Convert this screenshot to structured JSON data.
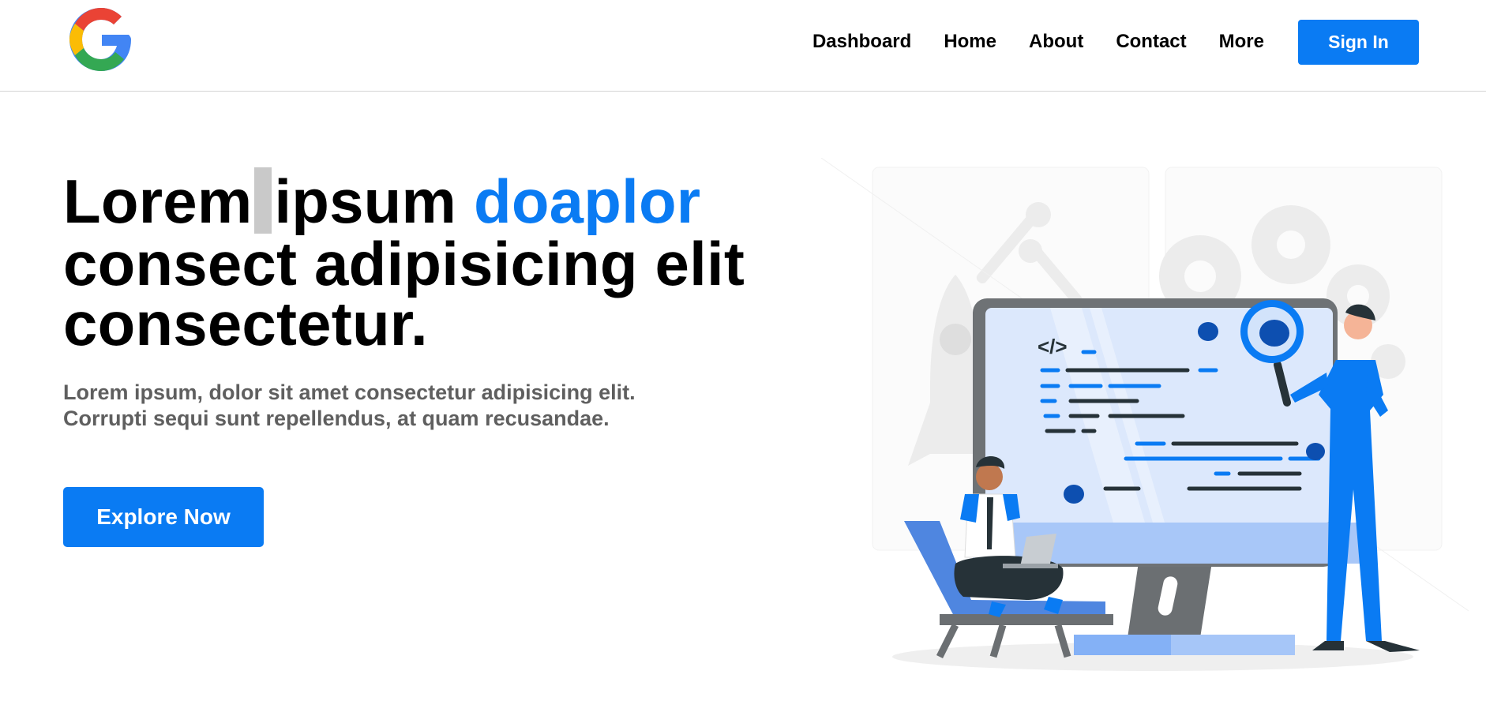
{
  "header": {
    "logo_letter": "G",
    "nav": [
      "Dashboard",
      "Home",
      "About",
      "Contact",
      "More"
    ],
    "signin_label": "Sign In"
  },
  "hero": {
    "title_word1": "Lorem",
    "title_word2": "ipsum",
    "title_accent": "doaplor",
    "title_line2": "consect adipisicing elit",
    "title_line3": "consectetur.",
    "subtitle": "Lorem ipsum, dolor sit amet consectetur adipisicing elit. Corrupti sequi sunt repellendus, at quam recusandae.",
    "cta_label": "Explore Now"
  },
  "illustration": {
    "code_tag": "</>",
    "icons": [
      "google-logo-icon",
      "rocket-icon",
      "wrench-icon",
      "gear-icon",
      "bug-icon",
      "magnifier-icon",
      "laptop-icon"
    ]
  },
  "colors": {
    "accent": "#0a7bf3",
    "title": "#000000",
    "subtitle": "#5f5f5f",
    "divider": "#d4d4d4",
    "google_red": "#ea4335",
    "google_yellow": "#fbbc05",
    "google_green": "#34a853",
    "google_blue": "#4285f4"
  }
}
